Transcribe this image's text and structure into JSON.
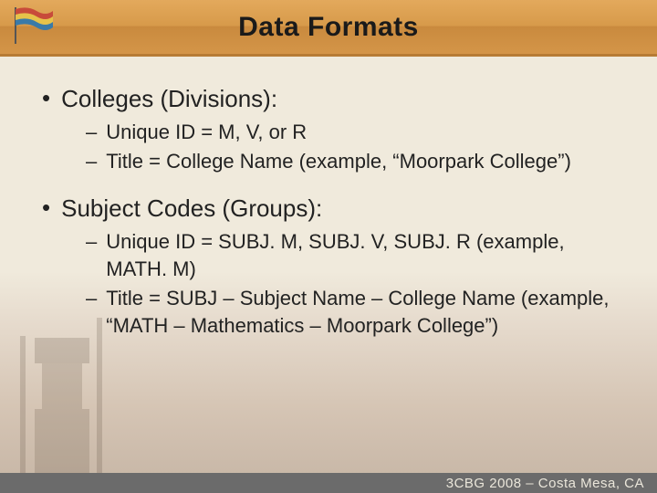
{
  "title": "Data Formats",
  "footer": "3CBG 2008 – Costa Mesa, CA",
  "bullets": [
    {
      "label": "Colleges (Divisions):",
      "sub": [
        "Unique ID = M, V, or R",
        "Title = College Name (example, “Moorpark College”)"
      ]
    },
    {
      "label": "Subject Codes (Groups):",
      "sub": [
        "Unique ID = SUBJ. M, SUBJ. V, SUBJ. R (example, MATH. M)",
        "Title = SUBJ – Subject Name – College Name (example, “MATH – Mathematics – Moorpark College”)"
      ]
    }
  ]
}
